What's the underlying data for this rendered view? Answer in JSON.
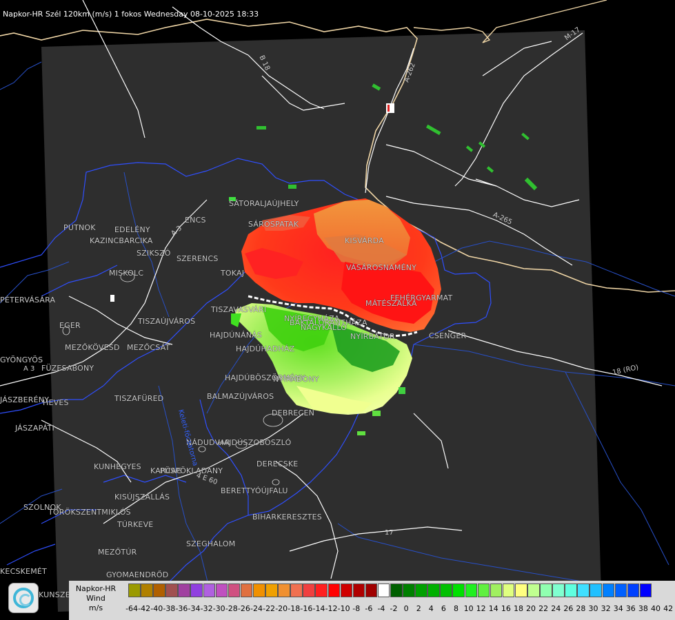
{
  "title": "Napkor-HR Szél 120km (m/s) 1 fokos Wednesday 08-10-2025 18:33",
  "places": [
    {
      "name": "SÁTORALJAÚJHELY"
    },
    {
      "name": "SÁROSPATAK"
    },
    {
      "name": "PUTNOK"
    },
    {
      "name": "EDELÉNY"
    },
    {
      "name": "KAZINCBARCIKA"
    },
    {
      "name": "ENCS"
    },
    {
      "name": "SZIKSZÓ"
    },
    {
      "name": "SZERENCS"
    },
    {
      "name": "KISVÁRDA"
    },
    {
      "name": "MISKOLC"
    },
    {
      "name": "TOKAJ"
    },
    {
      "name": "VÁSÁROSNAMÉNY"
    },
    {
      "name": "PÉTERVÁSÁRA"
    },
    {
      "name": "FEHÉRGYARMAT"
    },
    {
      "name": "MÁTÉSZALKA"
    },
    {
      "name": "TISZAVASVÁRI"
    },
    {
      "name": "TISZAÚJVÁROS"
    },
    {
      "name": "NYÍREGYHÁZA"
    },
    {
      "name": "BAKTALÓRÁNTHÁZA"
    },
    {
      "name": "NAGYKÁLLÓ"
    },
    {
      "name": "EGER"
    },
    {
      "name": "HAJDÚNÁNÁS"
    },
    {
      "name": "NYÍRBÁTOR"
    },
    {
      "name": "CSENGER"
    },
    {
      "name": "MEZŐKÖVESD"
    },
    {
      "name": "MEZŐCSÁT"
    },
    {
      "name": "HAJDÚHADHÁZ"
    },
    {
      "name": "GYÖNGYÖS"
    },
    {
      "name": "FÜZESABONY"
    },
    {
      "name": "HAJDÚBÖSZÖRMÉNY"
    },
    {
      "name": "NYÍRADONY"
    },
    {
      "name": "TISZAFÜRED"
    },
    {
      "name": "BALMAZÚJVÁROS"
    },
    {
      "name": "HEVES"
    },
    {
      "name": "DEBRECEN"
    },
    {
      "name": "JÁSZAPÁTI"
    },
    {
      "name": "NÁDUDVAR"
    },
    {
      "name": "HAJDÚSZOBOSZLÓ"
    },
    {
      "name": "KUNHEGYES"
    },
    {
      "name": "KARCAG"
    },
    {
      "name": "PÜSPÖKLADÁNY"
    },
    {
      "name": "DERECSKE"
    },
    {
      "name": "KISÚJSZÁLLÁS"
    },
    {
      "name": "BERETTYÓÚJFALU"
    },
    {
      "name": "SZOLNOK"
    },
    {
      "name": "TÖRÖKSZENTMIKLÓS"
    },
    {
      "name": "BIHARKERESZTES"
    },
    {
      "name": "TÚRKEVE"
    },
    {
      "name": "SZEGHALOM"
    },
    {
      "name": "MEZŐTÚR"
    },
    {
      "name": "GYOMAENDRŐD"
    },
    {
      "name": "KECSKEMÉT"
    },
    {
      "name": "KUNSZENTMÁRTON"
    },
    {
      "name": "JÁSZBERÉNY"
    }
  ],
  "roads": [
    {
      "name": "B 18"
    },
    {
      "name": "A-262"
    },
    {
      "name": "M-17"
    },
    {
      "name": "A 3"
    },
    {
      "name": "A-265"
    },
    {
      "name": "18 (RO)"
    },
    {
      "name": "A 3"
    },
    {
      "name": "4 E 60"
    },
    {
      "name": "17"
    },
    {
      "name": "Keleti-főcsatorna"
    }
  ],
  "legend": {
    "line1": "Napkor-HR",
    "line2": "Wind",
    "line3": "m/s",
    "colors": [
      "#9a9a00",
      "#b08000",
      "#b06000",
      "#a05050",
      "#a040a0",
      "#9040e0",
      "#b060e0",
      "#c050c0",
      "#d05080",
      "#e07040",
      "#f09000",
      "#f0a000",
      "#f09030",
      "#f07050",
      "#f04040",
      "#ff2020",
      "#ff0000",
      "#d00000",
      "#b00000",
      "#a00000",
      "#ffffff",
      "#006000",
      "#008000",
      "#00a000",
      "#00b000",
      "#00c000",
      "#00e000",
      "#20f020",
      "#60f040",
      "#a0f060",
      "#e0ff80",
      "#ffff80",
      "#c0ff90",
      "#90ffb0",
      "#80ffd0",
      "#60ffe0",
      "#40e0ff",
      "#20c0ff",
      "#0080ff",
      "#0060ff",
      "#0040ff",
      "#0000ff"
    ],
    "ticks": [
      "-64",
      "-42",
      "-40",
      "-38",
      "-36",
      "-34",
      "-32",
      "-30",
      "-28",
      "-26",
      "-24",
      "-22",
      "-20",
      "-18",
      "-16",
      "-14",
      "-12",
      "-10",
      "-8",
      "-6",
      "-4",
      "-2",
      "0",
      "2",
      "4",
      "6",
      "8",
      "10",
      "12",
      "14",
      "16",
      "18",
      "20",
      "22",
      "24",
      "26",
      "28",
      "30",
      "32",
      "34",
      "36",
      "38",
      "40",
      "42"
    ]
  },
  "colors": {
    "background": "#000000",
    "radar_area": "#2e2e2e",
    "rivers": "#2f4fff",
    "borders": "#f0d6a6",
    "roads": "#ffffff",
    "labels": "#c9c9c9"
  }
}
